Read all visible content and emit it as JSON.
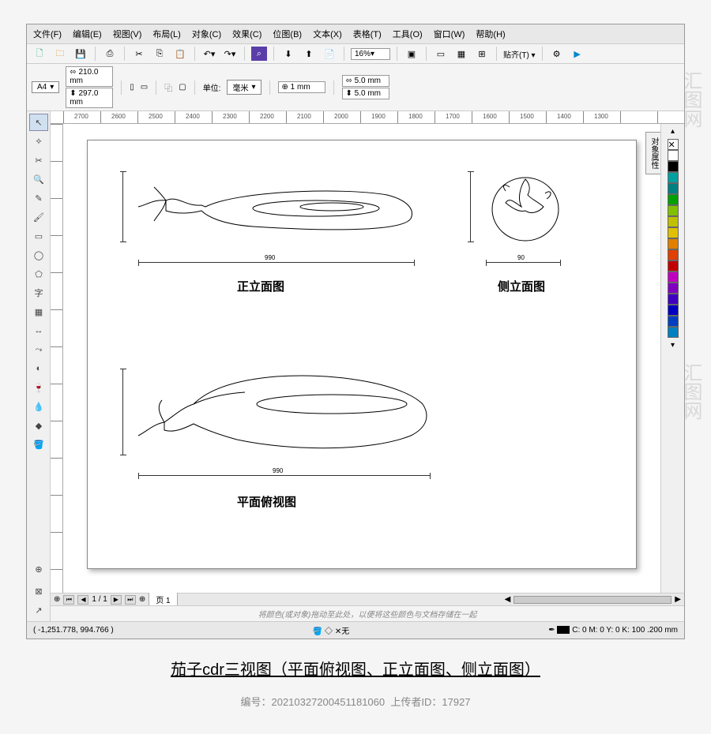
{
  "menu": [
    "文件(F)",
    "编辑(E)",
    "视图(V)",
    "布局(L)",
    "对象(C)",
    "效果(C)",
    "位图(B)",
    "文本(X)",
    "表格(T)",
    "工具(O)",
    "窗口(W)",
    "帮助(H)"
  ],
  "toolbar1": {
    "zoom": "16%",
    "snap_label": "贴齐(T)"
  },
  "propbar": {
    "page_preset": "A4",
    "width": "210.0 mm",
    "height": "297.0 mm",
    "units_label": "单位:",
    "units_value": "毫米",
    "nudge": "1 mm",
    "dup_x": "5.0 mm",
    "dup_y": "5.0 mm"
  },
  "ruler_h_ticks": [
    "2700",
    "2600",
    "2500",
    "2400",
    "2300",
    "2200",
    "2100",
    "2000",
    "1900",
    "1800",
    "1700",
    "1600",
    "1500",
    "1400",
    "1300"
  ],
  "views": {
    "front": "正立面图",
    "side": "侧立面图",
    "plan": "平面俯视图",
    "dim1": "990",
    "dim2": "90"
  },
  "pages": {
    "counter": "1 / 1",
    "tab": "页 1"
  },
  "hint": "将颜色(或对象)拖动至此处，以便将这些颜色与文档存储在一起",
  "status": {
    "cursor": "( -1,251.778, 994.766 )",
    "fill_none": "无",
    "color_readout": "C: 0 M: 0 Y: 0 K: 100  .200 mm"
  },
  "colors": [
    "#ffffff",
    "#000000",
    "#00a0a0",
    "#008080",
    "#00a000",
    "#80c000",
    "#c0c000",
    "#e0c000",
    "#e08000",
    "#e04000",
    "#c00000",
    "#c000c0",
    "#8000c0",
    "#4000c0",
    "#0000c0",
    "#0040c0",
    "#0080c0"
  ],
  "docker_label": "对象属性",
  "caption": "茄子cdr三视图（平面俯视图、正立面图、侧立面图）",
  "meta": {
    "id_label": "编号：",
    "id": "2021032720045118​1060",
    "uploader_label": "上传者ID：",
    "uploader": "17927"
  },
  "watermark": "汇图网"
}
